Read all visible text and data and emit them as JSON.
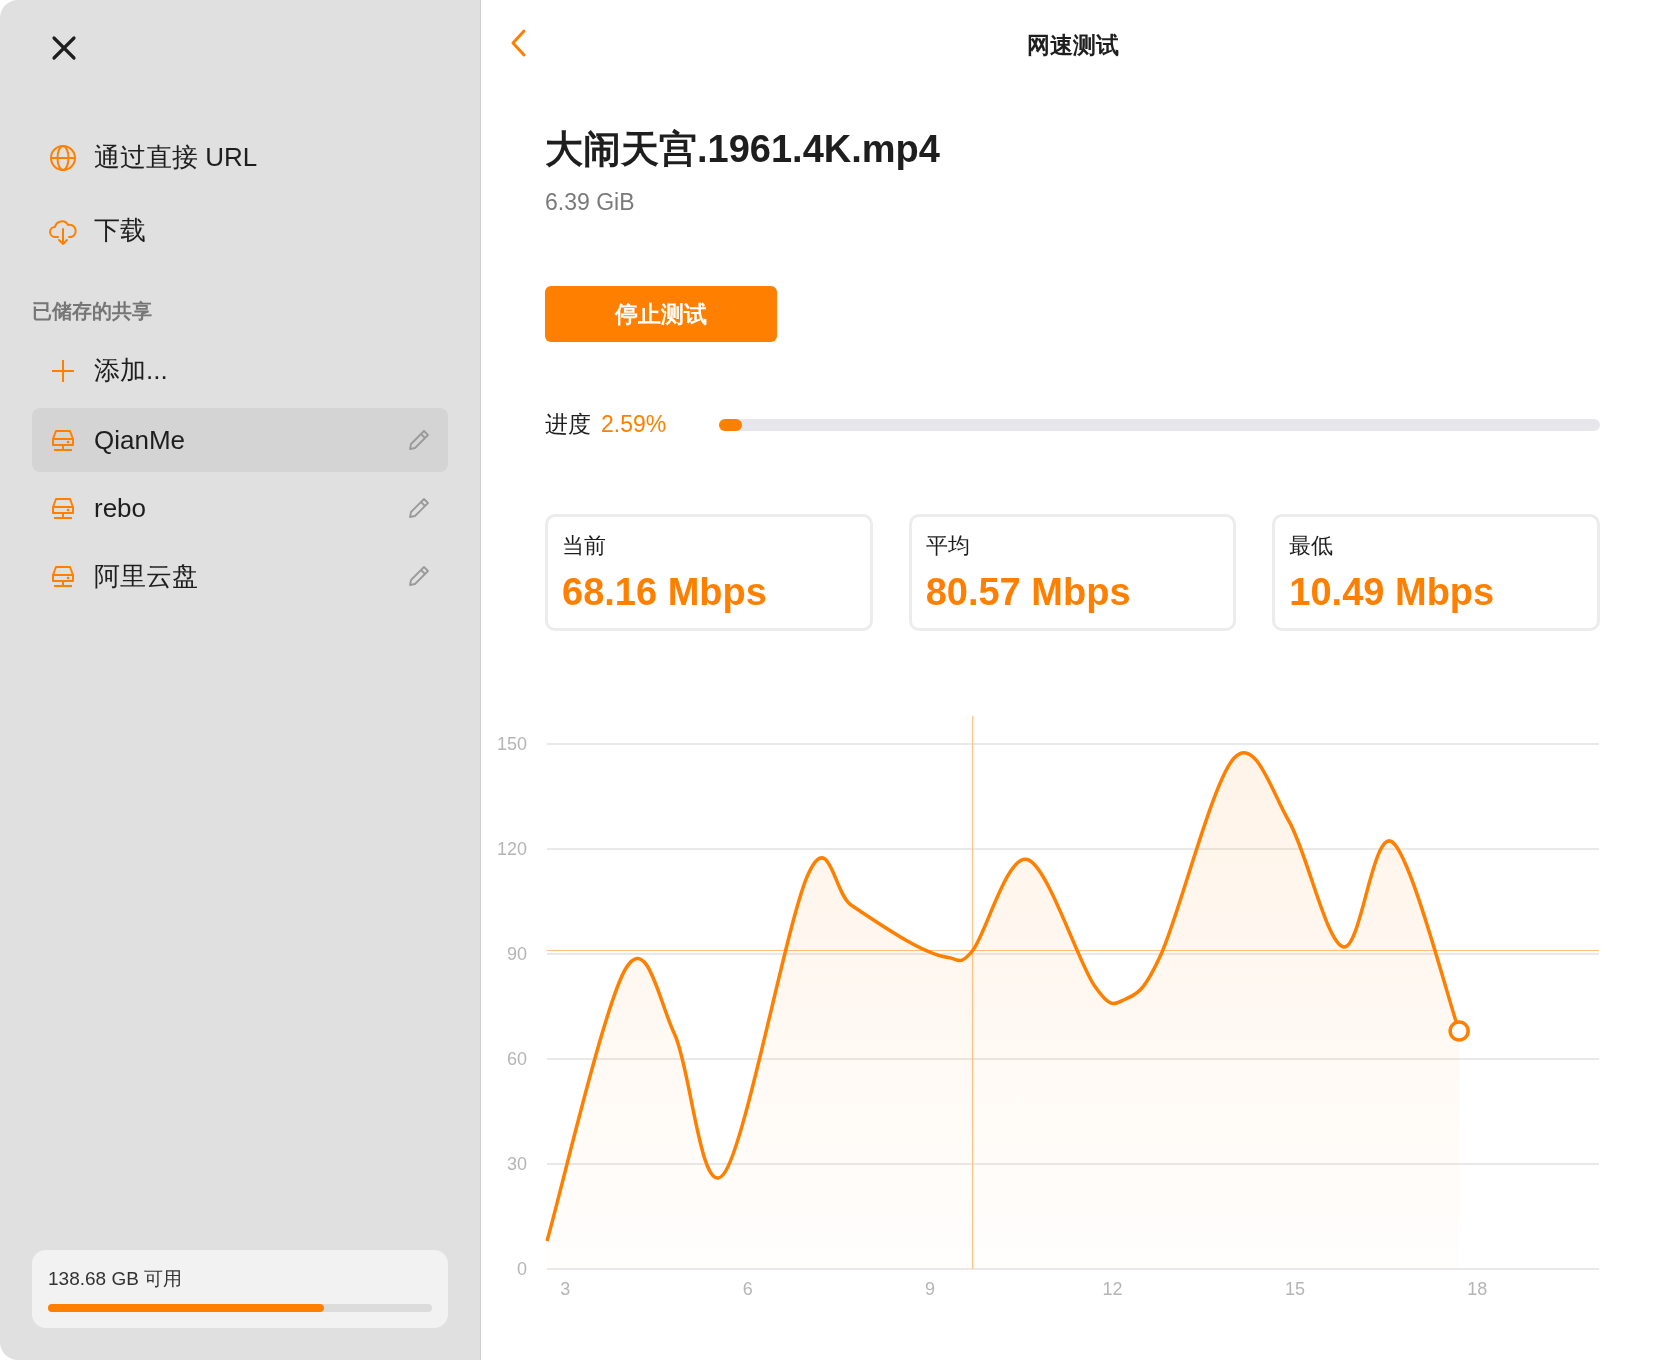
{
  "sidebar": {
    "links": [
      {
        "kind": "globe",
        "label": "通过直接 URL"
      },
      {
        "kind": "download",
        "label": "下载"
      }
    ],
    "section_title": "已储存的共享",
    "add_label": "添加...",
    "shares": [
      {
        "name": "QianMe",
        "selected": true
      },
      {
        "name": "rebo",
        "selected": false
      },
      {
        "name": "阿里云盘",
        "selected": false
      }
    ],
    "storage": {
      "label": "138.68 GB 可用",
      "level": 0.72
    }
  },
  "header": {
    "title": "网速测试"
  },
  "file": {
    "name": "大闹天宫.1961.4K.mp4",
    "size": "6.39 GiB"
  },
  "stop_button": "停止测试",
  "progress": {
    "label": "进度",
    "value": "2.59%",
    "level": 0.0259
  },
  "stats": [
    {
      "label": "当前",
      "value": "68.16 Mbps"
    },
    {
      "label": "平均",
      "value": "80.57 Mbps"
    },
    {
      "label": "最低",
      "value": "10.49 Mbps"
    }
  ],
  "chart": {
    "chart_data": {
      "type": "area",
      "grid": true,
      "xlim": [
        2.7,
        20
      ],
      "ylim": [
        0,
        150
      ],
      "xticks": [
        3,
        6,
        9,
        12,
        15,
        18
      ],
      "yticks": [
        0,
        30,
        60,
        90,
        120,
        150
      ],
      "series": [
        {
          "color": "#ff8000",
          "x": [
            2.7,
            4,
            4.8,
            5.6,
            7,
            7.7,
            8.7,
            9.3,
            9.7,
            10.6,
            11.7,
            12.2,
            12.8,
            14,
            14.9,
            15.8,
            16.6,
            17.7
          ],
          "values": [
            8,
            86,
            67,
            27,
            113,
            104,
            93,
            89,
            91,
            117,
            81,
            77,
            90,
            146,
            128,
            92,
            122,
            68
          ]
        }
      ],
      "ref_lines": [
        {
          "axis": "x",
          "value": 9.7
        },
        {
          "axis": "y",
          "value": 91
        }
      ]
    }
  }
}
